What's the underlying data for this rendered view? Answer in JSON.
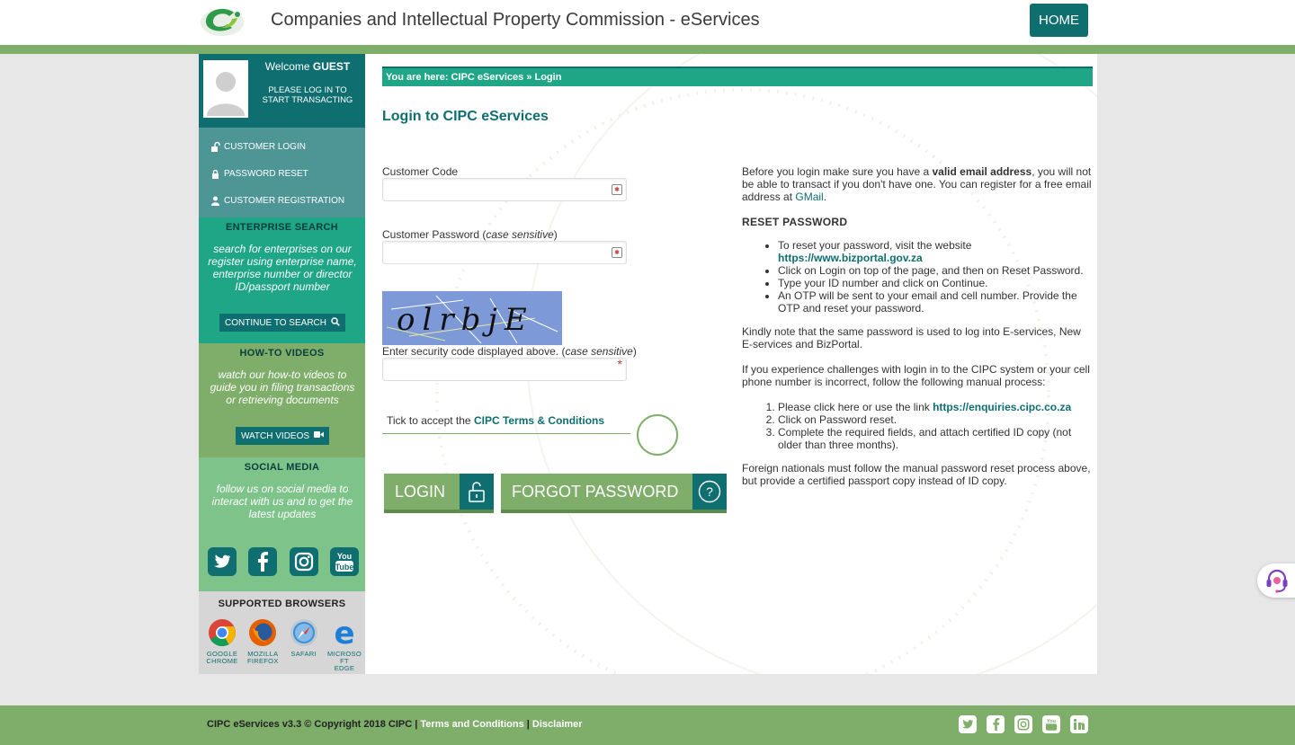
{
  "header": {
    "title": "Companies and Intellectual Property Commission - eServices",
    "home_label": "HOME"
  },
  "sidebar": {
    "welcome_prefix": "Welcome ",
    "welcome_user": "GUEST",
    "welcome_sub": "PLEASE LOG IN TO START TRANSACTING",
    "nav": [
      {
        "label": "CUSTOMER LOGIN",
        "icon": "unlock-icon"
      },
      {
        "label": "PASSWORD RESET",
        "icon": "lock-icon"
      },
      {
        "label": "CUSTOMER REGISTRATION",
        "icon": "user-icon"
      }
    ],
    "enterprise": {
      "heading": "ENTERPRISE SEARCH",
      "desc": "search for enterprises on our register using enterprise name, enterprise number or director ID/passport number",
      "button": "CONTINUE TO SEARCH"
    },
    "videos": {
      "heading": "HOW-TO VIDEOS",
      "desc": "watch our how-to videos to guide you in filing transactions or retrieving documents",
      "button": "WATCH VIDEOS"
    },
    "social": {
      "heading": "SOCIAL MEDIA",
      "desc": "follow us on social media to interact with us and to get the latest updates",
      "icons": [
        "twitter-icon",
        "facebook-icon",
        "instagram-icon",
        "youtube-icon"
      ]
    },
    "browsers": {
      "heading": "SUPPORTED BROWSERS",
      "items": [
        {
          "line1": "GOOGLE",
          "line2": "CHROME"
        },
        {
          "line1": "MOZILLA",
          "line2": "FIREFOX"
        },
        {
          "line1": "SAFARI",
          "line2": ""
        },
        {
          "line1": "MICROSO FT",
          "line2": "EDGE"
        }
      ]
    }
  },
  "main": {
    "breadcrumb": "You are here: CIPC eServices » Login",
    "title": "Login to CIPC eServices",
    "customer_code_label": "Customer Code",
    "password_label": "Customer Password (",
    "password_label_em": "case sensitive",
    "password_label_end": ")",
    "captcha_text": "olrbjE",
    "security_label": "Enter security code displayed above. (",
    "security_label_em": "case sensitive",
    "security_label_end": ")",
    "terms_prefix": "Tick to accept the ",
    "terms_link": "CIPC Terms & Conditions",
    "login_button": "LOGIN",
    "forgot_button": "FORGOT PASSWORD"
  },
  "info": {
    "p1_a": "Before you login make sure you have a ",
    "p1_b": "valid email address",
    "p1_c": ", you will not be able to transact if you don't have one. You can register for a free email address at ",
    "p1_link": "GMail",
    "p1_d": ".",
    "reset_heading": "RESET PASSWORD",
    "reset_1a": "To reset your password, visit the website ",
    "reset_1link": "https://www.bizportal.gov.za",
    "reset_2": "Click on Login on top of the page, and then on Reset Password.",
    "reset_3": "Type your ID number and click on Continue.",
    "reset_4": "An OTP will be sent to your email and cell number. Provide the OTP and reset your password.",
    "p2": "Kindly note that the same password is used to log into E-services, New E-services and BizPortal.",
    "p3": "If you experience challenges with login in to the CIPC system or your cell phone number is incorrect, follow the following manual process:",
    "manual_1a": "Please click here or use the link ",
    "manual_1link": "https://enquiries.cipc.co.za",
    "manual_2": "Click on Password reset.",
    "manual_3": "Complete the required fields, and attach certified ID copy (not older than three months).",
    "p4": "Foreign nationals must follow the manual password reset process above, but provide a certified passport copy instead of ID copy."
  },
  "footer": {
    "copyright": "CIPC eServices v3.3 © Copyright 2018 CIPC | ",
    "terms": "Terms and Conditions",
    "sep": " | ",
    "disclaimer": "Disclaimer",
    "icons": [
      "twitter-icon",
      "facebook-icon",
      "instagram-icon",
      "youtube-icon",
      "linkedin-icon"
    ]
  },
  "colors": {
    "teal_dark": "#0e6e70",
    "teal_green": "#1fa686",
    "green": "#7fae6a",
    "light_green": "#7dc38a"
  }
}
